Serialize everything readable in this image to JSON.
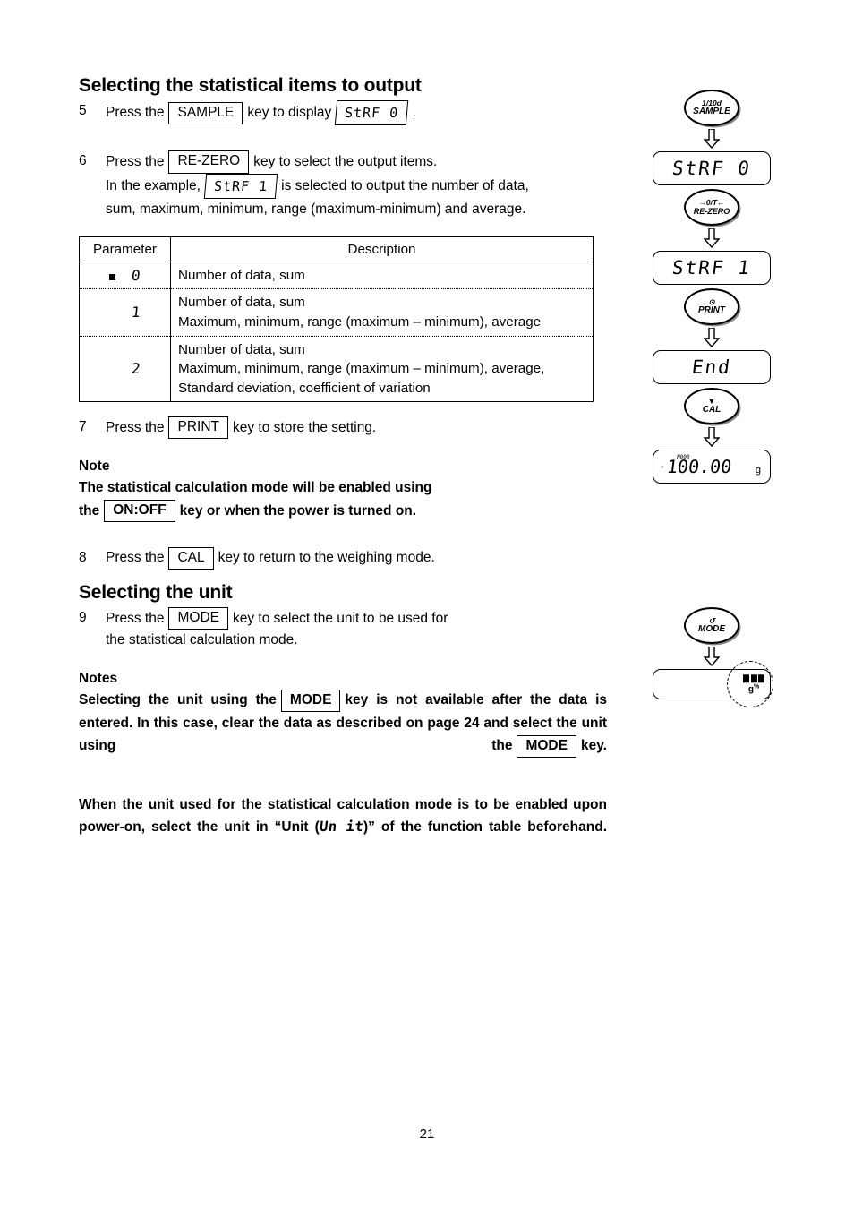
{
  "page": {
    "number": "21"
  },
  "section1": {
    "title": "Selecting the statistical items to output",
    "step5": {
      "num": "5",
      "pre": "Press the",
      "key": "SAMPLE",
      "mid": "key to display",
      "lcd": "StRF 0",
      "post": "."
    },
    "step6": {
      "num": "6",
      "pre": "Press the",
      "key": "RE-ZERO",
      "mid": "key to select the output items.",
      "line2_pre": "In the example,",
      "line2_lcd": "StRF 1",
      "line2_post": "is selected to output the number of data,",
      "line3": "sum, maximum, minimum, range (maximum-minimum) and average."
    },
    "step7": {
      "num": "7",
      "pre": "Press the",
      "key": "PRINT",
      "post": "key to store the setting."
    },
    "step8": {
      "num": "8",
      "pre": "Press the",
      "key": "CAL",
      "post": "key to return to the weighing mode."
    },
    "note": {
      "heading": "Note",
      "line1": "The statistical calculation mode will be enabled using",
      "line2_pre": "the",
      "line2_key": "ON:OFF",
      "line2_post": "key or when the power is turned on."
    }
  },
  "table": {
    "headers": [
      "Parameter",
      "Description"
    ],
    "rows": [
      {
        "param": "0",
        "default": true,
        "description": [
          "Number of data, sum"
        ]
      },
      {
        "param": "1",
        "default": false,
        "description": [
          "Number of data, sum",
          "Maximum, minimum, range (maximum – minimum), average"
        ]
      },
      {
        "param": "2",
        "default": false,
        "description": [
          "Number of data, sum",
          "Maximum, minimum, range (maximum – minimum), average,",
          "Standard deviation, coefficient of variation"
        ]
      }
    ]
  },
  "section2": {
    "title": "Selecting the unit",
    "step9": {
      "num": "9",
      "pre": "Press the",
      "key": "MODE",
      "post": "key to select the unit to be used for",
      "line2": "the statistical calculation mode."
    },
    "notes": {
      "heading": "Notes",
      "p1_a": "Selecting the unit using the",
      "p1_key1": "MODE",
      "p1_b": "key is not available after the data is entered. In this case, clear the data as described on page 24 and select the unit using the",
      "p1_key2": "MODE",
      "p1_c": "key.",
      "p2_a": "When the unit used for the statistical calculation mode is to be enabled upon power-on, select the unit in “Unit (",
      "p2_lcd": "Un it",
      "p2_b": ")” of the function table beforehand."
    }
  },
  "diagram": {
    "steps": [
      {
        "kind": "key",
        "top": "1/10d",
        "label": "SAMPLE"
      },
      {
        "kind": "arrow"
      },
      {
        "kind": "lcd",
        "text": "StRF 0"
      },
      {
        "kind": "key",
        "top": "→0/T←",
        "label": "RE-ZERO"
      },
      {
        "kind": "arrow"
      },
      {
        "kind": "lcd",
        "text": "StRF 1"
      },
      {
        "kind": "key",
        "top": "⊙",
        "label": "PRINT"
      },
      {
        "kind": "arrow"
      },
      {
        "kind": "lcd",
        "text": "End"
      },
      {
        "kind": "key",
        "top": "▼",
        "label": "CAL"
      },
      {
        "kind": "arrow"
      },
      {
        "kind": "weigh",
        "tiny": "N000",
        "value": "100.00",
        "unit": "g"
      }
    ]
  },
  "diagram2": {
    "key": {
      "top": "↺",
      "label": "MODE"
    },
    "unit_glyph": "g",
    "unit_pct": "%"
  }
}
